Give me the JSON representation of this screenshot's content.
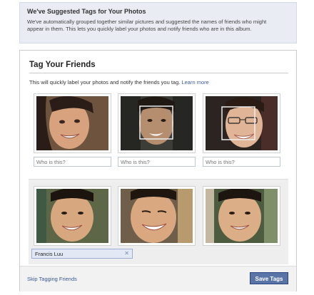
{
  "notice": {
    "title": "We've Suggested Tags for Your Photos",
    "line1": "We've automatically grouped together similar pictures and suggested the names of friends who might",
    "line2": "appear in them. This lets you quickly label your photos and notify friends who are in this album."
  },
  "panel": {
    "title": "Tag Your Friends",
    "subtitle": "This will quickly label your photos and notify the friends you tag.",
    "learn_more": "Learn more"
  },
  "group1": {
    "placeholder": "Who is this?",
    "inputs": [
      "Who is this?",
      "Who is this?",
      "Who is this?"
    ]
  },
  "group2": {
    "tag_name": "Francis Luu",
    "remove_glyph": "✕"
  },
  "footer": {
    "skip": "Skip Tagging Friends",
    "save": "Save Tags"
  }
}
